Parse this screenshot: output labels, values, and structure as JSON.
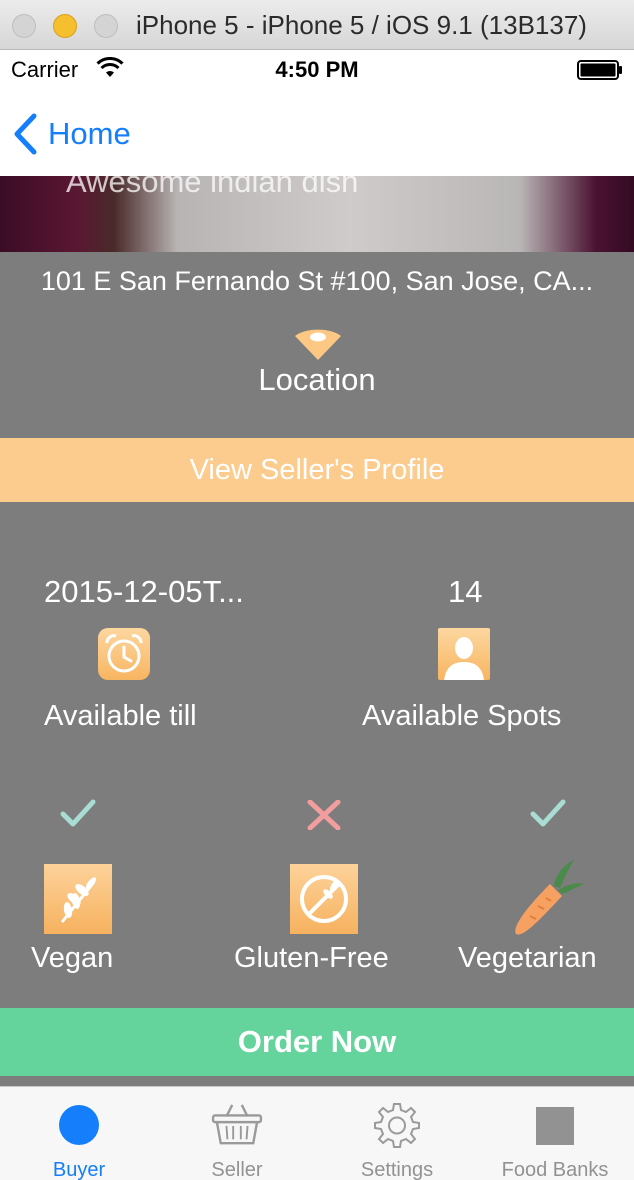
{
  "simulator": {
    "title": "iPhone 5 - iPhone 5 / iOS 9.1 (13B137)"
  },
  "status_bar": {
    "carrier": "Carrier",
    "time": "4:50 PM"
  },
  "nav": {
    "back_label": "Home"
  },
  "hero": {
    "caption": "Awesome indian dish"
  },
  "location": {
    "address": "101 E San Fernando St #100, San Jose, CA...",
    "label": "Location"
  },
  "profile_button": {
    "label": "View Seller's Profile"
  },
  "availability": {
    "date_value": "2015-12-05T...",
    "date_label": "Available till",
    "spots_value": "14",
    "spots_label": "Available Spots"
  },
  "dietary": [
    {
      "label": "Vegan",
      "status": "yes"
    },
    {
      "label": "Gluten-Free",
      "status": "no"
    },
    {
      "label": "Vegetarian",
      "status": "yes"
    }
  ],
  "order_button": {
    "label": "Order Now"
  },
  "tabs": [
    {
      "label": "Buyer",
      "icon": "circle-icon",
      "selected": true
    },
    {
      "label": "Seller",
      "icon": "basket-icon",
      "selected": false
    },
    {
      "label": "Settings",
      "icon": "gear-icon",
      "selected": false
    },
    {
      "label": "Food Banks",
      "icon": "square-icon",
      "selected": false
    }
  ],
  "colors": {
    "accent_blue": "#157efb",
    "profile_orange": "#fccb8e",
    "order_green": "#64d39c",
    "panel_grey": "#7d7d7d",
    "check_teal": "#a9dcd2",
    "cross_pink": "#f29e9e"
  }
}
